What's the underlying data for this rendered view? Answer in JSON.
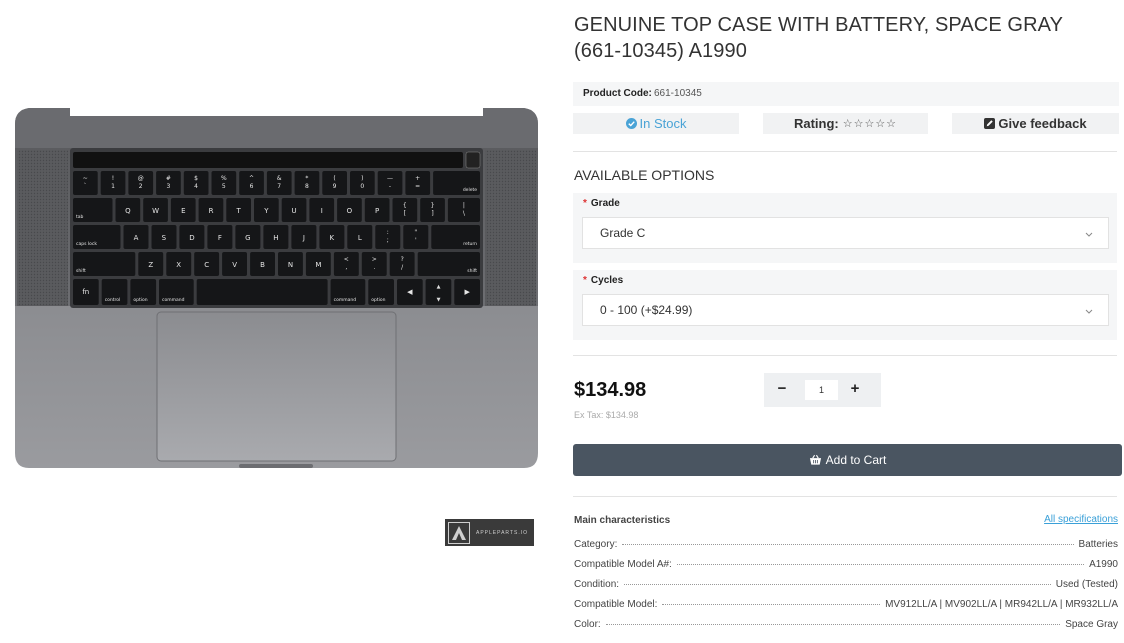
{
  "product": {
    "title": "GENUINE TOP CASE WITH BATTERY, SPACE GRAY (661-10345) A1990",
    "code_label": "Product Code:",
    "code_value": "661-10345"
  },
  "status": {
    "stock": "In Stock",
    "rating_label": "Rating:",
    "rating_stars": "☆☆☆☆☆",
    "rating_value": 0,
    "feedback": "Give feedback"
  },
  "options": {
    "heading": "AVAILABLE OPTIONS",
    "grade": {
      "label": "Grade",
      "value": "Grade C"
    },
    "cycles": {
      "label": "Cycles",
      "value": "0 - 100 (+$24.99)"
    }
  },
  "pricing": {
    "price": "$134.98",
    "ex_tax": "Ex Tax: $134.98",
    "quantity": "1"
  },
  "cart": {
    "label": "Add to Cart"
  },
  "specs": {
    "heading": "Main characteristics",
    "all_link": "All specifications",
    "rows": [
      {
        "key": "Category:",
        "value": "Batteries"
      },
      {
        "key": "Compatible Model A#:",
        "value": "A1990"
      },
      {
        "key": "Condition:",
        "value": "Used (Tested)"
      },
      {
        "key": "Compatible Model:",
        "value": "MV912LL/A | MV902LL/A | MR942LL/A | MR932LL/A"
      },
      {
        "key": "Color:",
        "value": "Space Gray"
      }
    ]
  },
  "image": {
    "logo_text": "APPLEPARTS.IO",
    "keys": {
      "row1": [
        "~\n`",
        "!\n1",
        "@\n2",
        "#\n3",
        "$\n4",
        "%\n5",
        "^\n6",
        "&\n7",
        "*\n8",
        "(\n9",
        ")\n0",
        "—\n-",
        "+\n=",
        "delete"
      ],
      "row2": [
        "tab",
        "Q",
        "W",
        "E",
        "R",
        "T",
        "Y",
        "U",
        "I",
        "O",
        "P",
        "{\n[",
        "}\n]",
        "|\n\\"
      ],
      "row3": [
        "caps lock",
        "A",
        "S",
        "D",
        "F",
        "G",
        "H",
        "J",
        "K",
        "L",
        ":\n;",
        "\"\n'",
        "return"
      ],
      "row4": [
        "shift",
        "Z",
        "X",
        "C",
        "V",
        "B",
        "N",
        "M",
        "<\n,",
        ">\n.",
        "?\n/",
        "shift"
      ],
      "row5": [
        "fn",
        "control",
        "option",
        "command",
        "",
        "command",
        "option",
        "◀",
        "▲▼",
        "▶"
      ]
    }
  },
  "colors": {
    "accent": "#4aa3d6",
    "button": "#4a5561",
    "required": "#d33",
    "panel": "#f5f6f7"
  },
  "icons": [
    "check-circle-icon",
    "edit-icon",
    "cart-icon",
    "chevron-down-icon",
    "minus-icon",
    "plus-icon"
  ]
}
